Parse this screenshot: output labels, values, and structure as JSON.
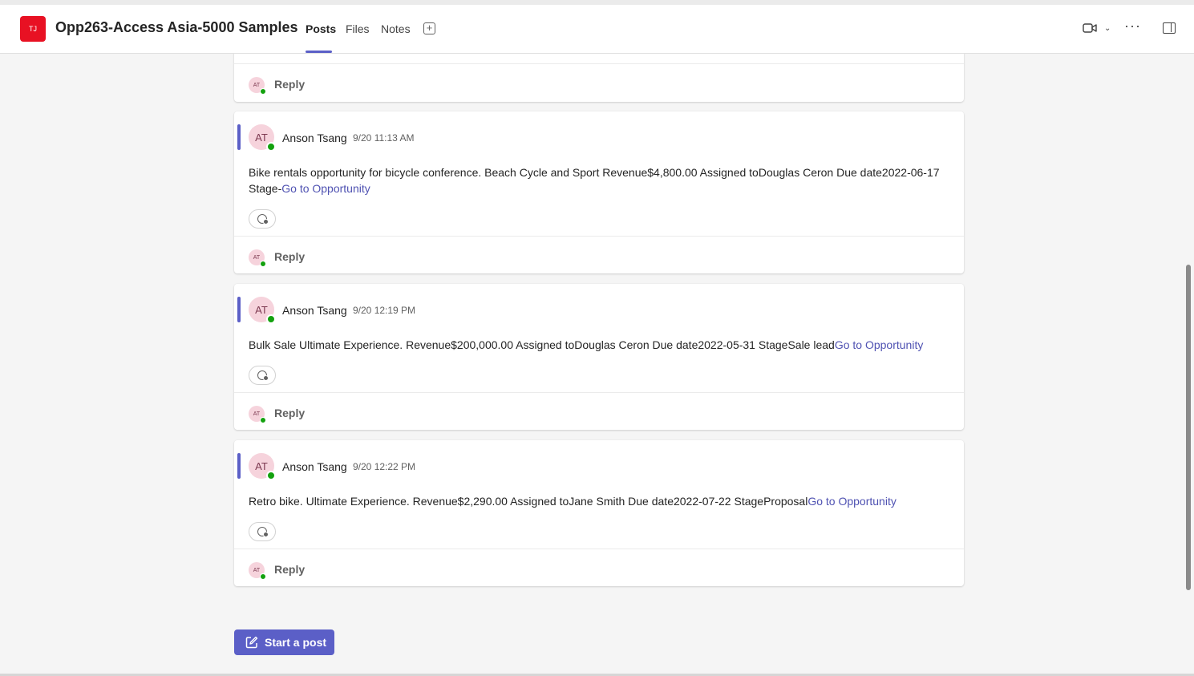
{
  "header": {
    "team_initials": "TJ",
    "channel_title": "Opp263-Access Asia-5000 Samples",
    "tabs": [
      {
        "label": "Posts",
        "active": true
      },
      {
        "label": "Files",
        "active": false
      },
      {
        "label": "Notes",
        "active": false
      }
    ],
    "add_tab_symbol": "+",
    "more_symbol": "···"
  },
  "posts": [
    {
      "author_initials": "AT",
      "author": "Anson Tsang",
      "time": "9/20 11:13 AM",
      "text": "Bike rentals opportunity for bicycle conference. Beach Cycle and Sport Revenue$4,800.00 Assigned toDouglas Ceron Due date2022-06-17 Stage-",
      "link": "Go to Opportunity",
      "reply_label": "Reply"
    },
    {
      "author_initials": "AT",
      "author": "Anson Tsang",
      "time": "9/20 12:19 PM",
      "text": "Bulk Sale Ultimate Experience. Revenue$200,000.00 Assigned toDouglas Ceron Due date2022-05-31 StageSale lead",
      "link": "Go to Opportunity",
      "reply_label": "Reply"
    },
    {
      "author_initials": "AT",
      "author": "Anson Tsang",
      "time": "9/20 12:22 PM",
      "text": "Retro bike. Ultimate Experience. Revenue$2,290.00 Assigned toJane Smith Due date2022-07-22 StageProposal",
      "link": "Go to Opportunity",
      "reply_label": "Reply"
    }
  ],
  "top_card": {
    "reply_initials": "AT",
    "reply_label": "Reply"
  },
  "start_post_label": "Start a post",
  "colors": {
    "accent": "#5b5fc7",
    "link": "#4f52b2",
    "team_avatar": "#e81123",
    "presence": "#13a10e"
  },
  "icons": [
    "video-icon",
    "chevron-down-icon",
    "more-icon",
    "panel-icon",
    "add-reaction-icon",
    "compose-icon"
  ]
}
